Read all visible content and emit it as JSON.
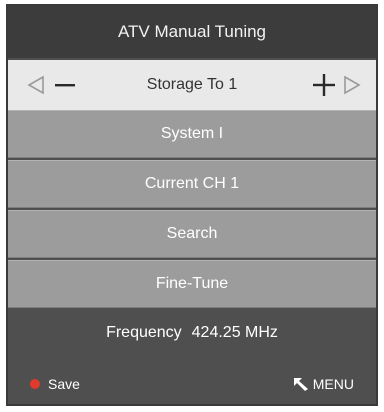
{
  "header": {
    "title": "ATV Manual Tuning"
  },
  "storage": {
    "label": "Storage To 1",
    "left_icon": "left-triangle-icon",
    "minus_icon": "minus-icon",
    "plus_icon": "plus-icon",
    "right_icon": "right-triangle-icon"
  },
  "menu": {
    "items": [
      {
        "label": "System I"
      },
      {
        "label": "Current CH 1"
      },
      {
        "label": "Search"
      },
      {
        "label": "Fine-Tune"
      }
    ]
  },
  "footer": {
    "frequency_label": "Frequency",
    "frequency_value": "424.25 MHz",
    "save_label": "Save",
    "menu_label": "MENU",
    "save_dot_color": "#e03a2f"
  },
  "colors": {
    "panel": "#4f4f4f",
    "header": "#3c3c3c",
    "storage_row": "#e9e9e9",
    "menu_item": "#9c9c9c"
  }
}
